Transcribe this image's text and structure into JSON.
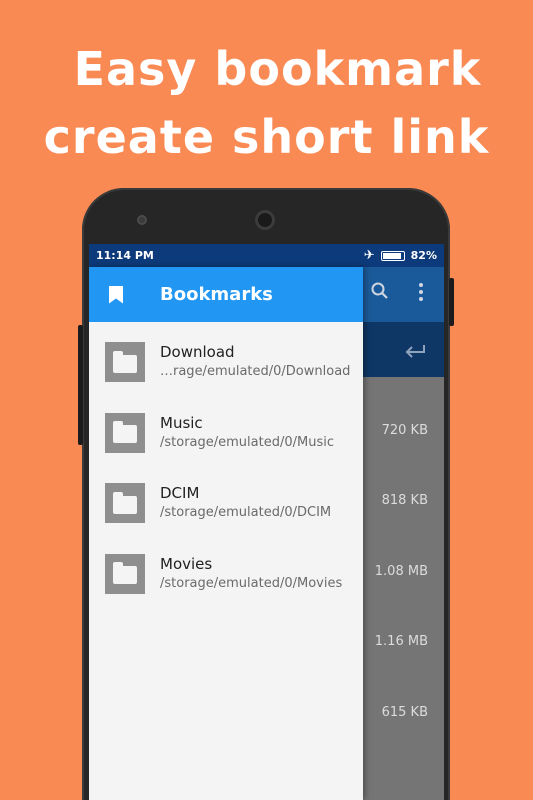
{
  "promo": {
    "line1": "Easy bookmark",
    "line2": "create short link"
  },
  "status_bar": {
    "time": "11:14 PM",
    "battery": "82%"
  },
  "drawer": {
    "title": "Bookmarks",
    "items": [
      {
        "name": "Download",
        "path": "…rage/emulated/0/Download"
      },
      {
        "name": "Music",
        "path": "/storage/emulated/0/Music"
      },
      {
        "name": "DCIM",
        "path": "/storage/emulated/0/DCIM"
      },
      {
        "name": "Movies",
        "path": "/storage/emulated/0/Movies"
      }
    ]
  },
  "background_list": {
    "sizes": [
      "720 KB",
      "818 KB",
      "1.08 MB",
      "1.16 MB",
      "615 KB"
    ]
  },
  "icons": [
    "bookmark-icon",
    "folder-icon",
    "search-icon",
    "more-vert-icon",
    "back-arrow-icon",
    "airplane-icon",
    "battery-icon"
  ],
  "colors": {
    "background": "#f98a54",
    "drawer_header": "#2196f3",
    "status_bar": "#0d3a7a"
  }
}
